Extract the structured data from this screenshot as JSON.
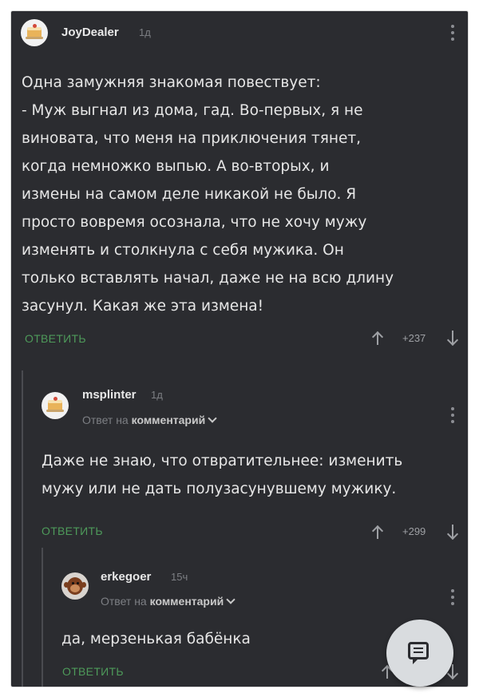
{
  "comments": [
    {
      "username": "JoyDealer",
      "time": "1д",
      "text": "Одна замужняя знакомая повествует:\n- Муж выгнал из дома, гад. Во-первых, я не\nвиновата, что меня на приключения тянет,\nкогда немножко выпью. А во-вторых, и\nизмены на самом деле никакой не было. Я\nпросто вовремя осознала, что не хочу мужу\nизменять и столкнула с себя мужика. Он\nтолько вставлять начал, даже не на всю длину\nзасунул. Какая же эта измена!",
      "reply_label": "ОТВЕТИТЬ",
      "score": "+237",
      "avatar_icon": "cake-icon"
    },
    {
      "username": "msplinter",
      "time": "1д",
      "reply_prefix": "Ответ на",
      "reply_target": "комментарий",
      "text": "Даже не знаю, что отвратительнее: изменить\nмужу или не дать полузасунувшему мужику.",
      "reply_label": "ОТВЕТИТЬ",
      "score": "+299",
      "avatar_icon": "cake-icon"
    },
    {
      "username": "erkegoer",
      "time": "15ч",
      "reply_prefix": "Ответ на",
      "reply_target": "комментарий",
      "text": "да, мерзенькая бабёнка",
      "reply_label": "ОТВЕТИТЬ",
      "avatar_icon": "monkey-icon"
    }
  ],
  "fab": {
    "icon": "chat-icon"
  },
  "colors": {
    "background": "#2b2c30",
    "accent_green": "#4e9a5a",
    "text": "#e6e6e6",
    "muted": "#7d7f84"
  }
}
